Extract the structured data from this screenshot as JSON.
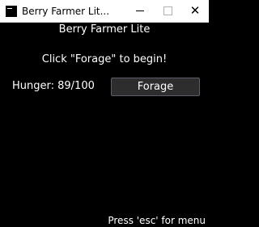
{
  "window": {
    "title": "Berry Farmer Lit...",
    "controls": {
      "minimize": "minimize-icon",
      "maximize": "maximize-icon",
      "close_glyph": "✕"
    }
  },
  "game": {
    "title": "Berry Farmer Lite",
    "message": "Click \"Forage\" to begin!",
    "hunger_label": "Hunger: 89/100",
    "forage_button": "Forage",
    "footer_hint": "Press 'esc' for menu"
  },
  "colors": {
    "background": "#000000",
    "text": "#ffffff",
    "button_bg": "#2d2d2d",
    "button_border": "#5a5f6a"
  }
}
